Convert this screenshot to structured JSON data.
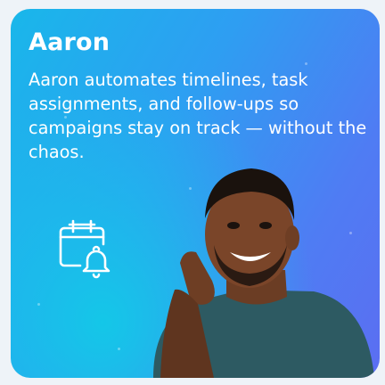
{
  "agent": {
    "name": "Aaron",
    "description": "Aaron automates timelines, task assignments, and follow-ups so campaigns stay on track — without the chaos."
  },
  "icons": {
    "schedule_icon": "calendar-bell-icon"
  },
  "colors": {
    "gradient_start": "#19b7ea",
    "gradient_end": "#5b6ef2",
    "text": "#ffffff"
  }
}
